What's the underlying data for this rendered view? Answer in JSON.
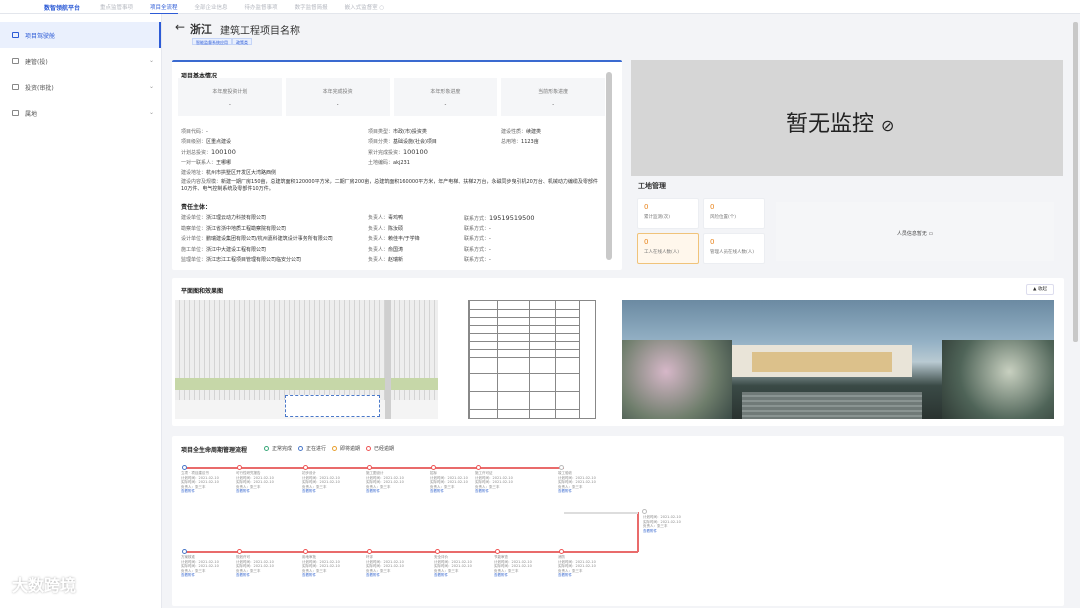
{
  "topnav": {
    "brand": "数智领航平台",
    "tabs": [
      "重点监管事项",
      "项目全流程",
      "全部企业信息",
      "待办监督事项",
      "数字监督简报",
      "嵌入式监督室 ○"
    ]
  },
  "sidebar": {
    "items": [
      "项目驾驶舱",
      "建管(投)",
      "投资(审批)",
      "属地"
    ]
  },
  "header": {
    "back": "←",
    "province": "浙江",
    "title": "建筑工程项目名称",
    "tags": [
      "智能监督系统应用",
      "政策类"
    ]
  },
  "basic": {
    "title": "项目基本情况",
    "stats": [
      {
        "label": "本年度投资计划",
        "value": "-"
      },
      {
        "label": "本年完成投资",
        "value": "-"
      },
      {
        "label": "本年形象进度",
        "value": "-"
      },
      {
        "label": "当前形象进度",
        "value": "-"
      }
    ],
    "rows": [
      {
        "k": "项目代码：",
        "v": "-"
      },
      {
        "k": "项目类型：",
        "v": "市政(市)投资类"
      },
      {
        "k": "建设性质：",
        "v": "续建类"
      },
      {
        "k": "项目级别：",
        "v": "区重点建设"
      },
      {
        "k": "项目分类：",
        "v": "基础设施(社会)项目"
      },
      {
        "k": "总用地：",
        "v": "1123亩"
      },
      {
        "k": "计划总投资：",
        "v": "100100"
      },
      {
        "k": "累计完成投资：",
        "v": "100100"
      },
      {
        "k": "一对一联系人：",
        "v": "王哪哪"
      },
      {
        "k": "土地编码：",
        "v": "akj231"
      },
      {
        "k": "建设地址：",
        "v": "杭州市拱墅区开发区大湾路西侧"
      },
      {
        "k": "建设内容及规模：",
        "v": "新建一期厂房150亩，总建筑面积120000平方米，二期厂房200亩，总建筑面积160000平方米，年产电梯、扶梯2万台，永磁同步曳引机20万台、机械动力编缆及零部件10万件、电气控制系统及零部件10万件。"
      }
    ],
    "resp_title": "责任主体：",
    "resp": [
      {
        "k": "建设单位：",
        "v": "浙江理云动力科技有限公司",
        "pk": "负责人：",
        "pv": "毒鸡鸭",
        "ck": "联系方式：",
        "cv": "19519519500"
      },
      {
        "k": "勘察单位：",
        "v": "浙江省浙中地质工程勘察院有限公司",
        "pk": "负责人：",
        "pv": "陈汝硕",
        "ck": "联系方式：",
        "cv": "-"
      },
      {
        "k": "设计单位：",
        "v": "鹏瑞建设集团有限公司/杭州嘉科建筑设计事务所有限公司",
        "pk": "负责人：",
        "pv": "赖佳丰/于学锋",
        "ck": "联系方式：",
        "cv": "-"
      },
      {
        "k": "施工单位：",
        "v": "浙江中大建设工程有限公司",
        "pk": "负责人：",
        "pv": "俞国涛",
        "ck": "联系方式：",
        "cv": "-"
      },
      {
        "k": "监理单位：",
        "v": "浙江忠江工程项目管理有限公司临安分公司",
        "pk": "负责人：",
        "pv": "赵瑞新",
        "ck": "联系方式：",
        "cv": "-"
      }
    ]
  },
  "monitor": {
    "text": "暂无监控"
  },
  "site": {
    "title": "工地管理",
    "boxes": [
      {
        "n": "0",
        "l": "累计监测(次)"
      },
      {
        "n": "0",
        "l": "风险位置(个)"
      },
      {
        "n": "0",
        "l": "工人在线人数(人)"
      },
      {
        "n": "0",
        "l": "管理人员在线人数(人)"
      }
    ],
    "wide": "人员信息暂无"
  },
  "plans": {
    "title": "平面图和效果图",
    "collapse": "▲ 收起"
  },
  "lifecycle": {
    "title": "项目全生命周期管理流程",
    "legend": [
      "正常完成",
      "正在进行",
      "即将逾期",
      "已经逾期"
    ],
    "legend_colors": [
      "#3aa87a",
      "#4a78c9",
      "#e8a030",
      "#e55"
    ],
    "top": [
      "立项 · 项目建议书",
      "可行性研究报告",
      "初步设计",
      "施工图设计",
      "招标",
      "施工许可证",
      "竣工验收"
    ],
    "bottom": [
      "方案核准",
      "规划许可",
      "用地审批",
      "环评",
      "安全评价",
      "节能审查",
      "消防"
    ],
    "info": [
      "计划时间：2021-02-10",
      "实际时间：2021-02-10",
      "负责人：张三丰",
      "查看附件"
    ]
  },
  "watermark": "大数跨境"
}
